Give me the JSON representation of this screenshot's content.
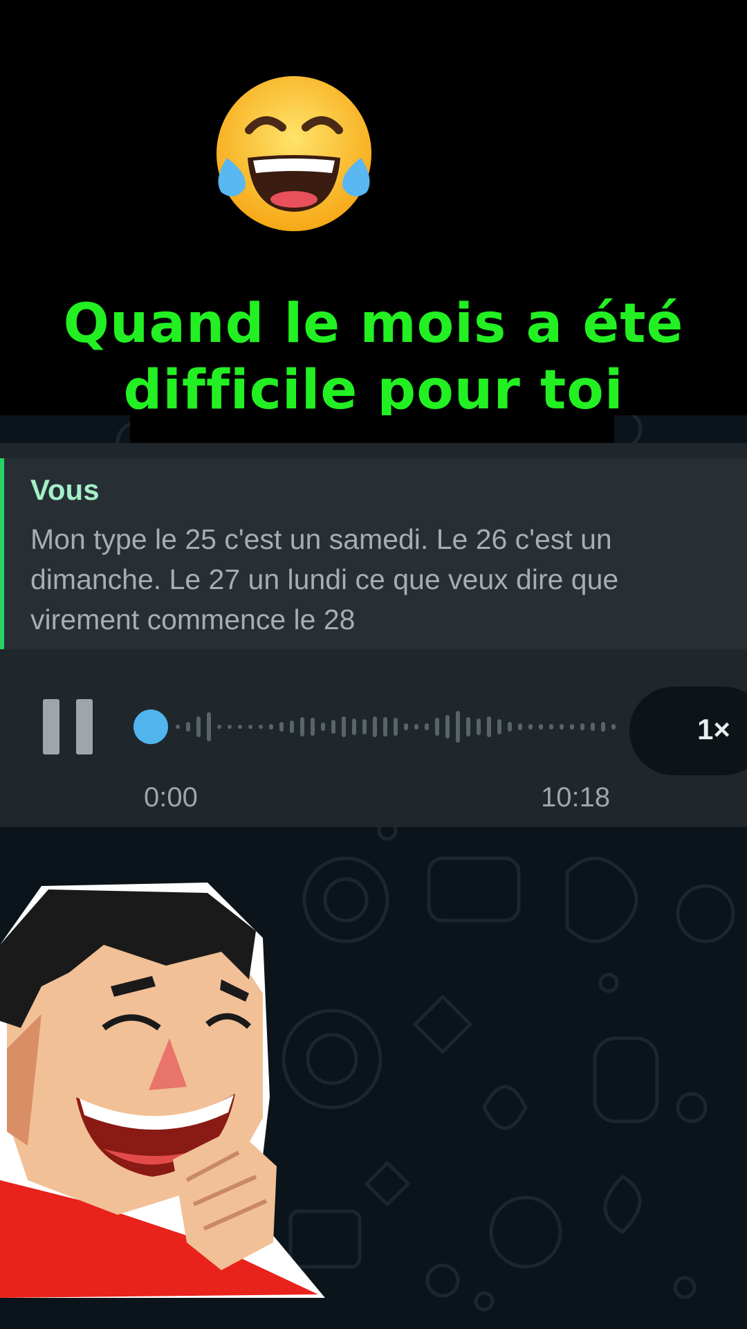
{
  "meme": {
    "caption": "Quand le mois a été\ndifficile pour toi",
    "emoji_icon": "face-with-tears-of-joy-icon"
  },
  "message": {
    "quote_author": "Vous",
    "quote_text": "Mon type le 25 c'est un samedi. Le 26 c'est un\ndimanche. Le 27 un lundi ce que veux dire que\nvirement commence le 28",
    "voice": {
      "elapsed": "0:00",
      "duration": "10:18",
      "speed": "1×",
      "progress": 0
    }
  },
  "sticker": {
    "icon": "laughing-man-sticker"
  },
  "colors": {
    "caption": "#22f022",
    "accent": "#25d366",
    "chat_bg": "#0b141a",
    "bubble": "#1f272c",
    "waveform_dot": "#4fb5ec"
  }
}
